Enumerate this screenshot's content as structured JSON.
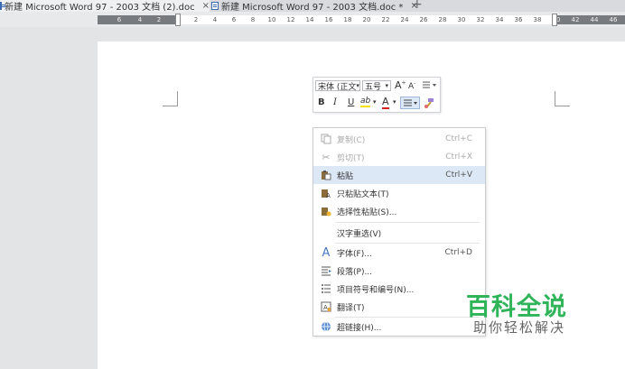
{
  "tabs": [
    {
      "title": "新建 Microsoft Word 97 - 2003 文档 (2).doc",
      "close": "×"
    },
    {
      "title": "新建 Microsoft Word 97 - 2003 文档.doc *",
      "close": "×"
    }
  ],
  "new_tab": "+",
  "ruler": {
    "left_numbers": [
      "6",
      "4",
      "2"
    ],
    "right_numbers": [
      "2",
      "4",
      "6",
      "8",
      "10",
      "12",
      "14",
      "16",
      "18",
      "20",
      "22",
      "24",
      "26",
      "28",
      "30",
      "32",
      "34",
      "36",
      "38",
      "40",
      "42",
      "44",
      "46"
    ]
  },
  "mini_toolbar": {
    "font_name": "宋体 (正文",
    "font_size": "五号",
    "grow_font": "A",
    "shrink_font": "A",
    "bold": "B",
    "italic": "I",
    "underline": "U",
    "highlight": "ab",
    "font_color": "A",
    "dropdown_arrow": "▾"
  },
  "context_menu": [
    {
      "label": "复制(C)",
      "shortcut": "Ctrl+C",
      "icon": "copy-icon",
      "state": "disabled"
    },
    {
      "label": "剪切(T)",
      "shortcut": "Ctrl+X",
      "icon": "scissors-icon",
      "state": "disabled"
    },
    {
      "label": "粘贴",
      "shortcut": "Ctrl+V",
      "icon": "paste-icon",
      "state": "highlighted"
    },
    {
      "label": "只粘贴文本(T)",
      "shortcut": "",
      "icon": "paste-text-icon",
      "state": "normal"
    },
    {
      "label": "选择性粘贴(S)...",
      "shortcut": "",
      "icon": "paste-special-icon",
      "state": "normal"
    },
    {
      "label": "汉字重选(V)",
      "shortcut": "",
      "icon": "",
      "state": "normal"
    },
    {
      "label": "字体(F)...",
      "shortcut": "Ctrl+D",
      "icon": "font-icon",
      "state": "normal"
    },
    {
      "label": "段落(P)...",
      "shortcut": "",
      "icon": "paragraph-icon",
      "state": "normal"
    },
    {
      "label": "项目符号和编号(N)...",
      "shortcut": "",
      "icon": "bullets-icon",
      "state": "normal"
    },
    {
      "label": "翻译(T)",
      "shortcut": "",
      "icon": "translate-icon",
      "state": "normal"
    },
    {
      "label": "超链接(H)...",
      "shortcut": "",
      "icon": "hyperlink-icon",
      "state": "normal"
    }
  ],
  "watermark": {
    "title": "百科全说",
    "subtitle": "助你轻松解决"
  },
  "colors": {
    "highlight_row": "#dde8f6",
    "watermark_green": "#2fb45a",
    "ruler_dark": "#777b80"
  }
}
